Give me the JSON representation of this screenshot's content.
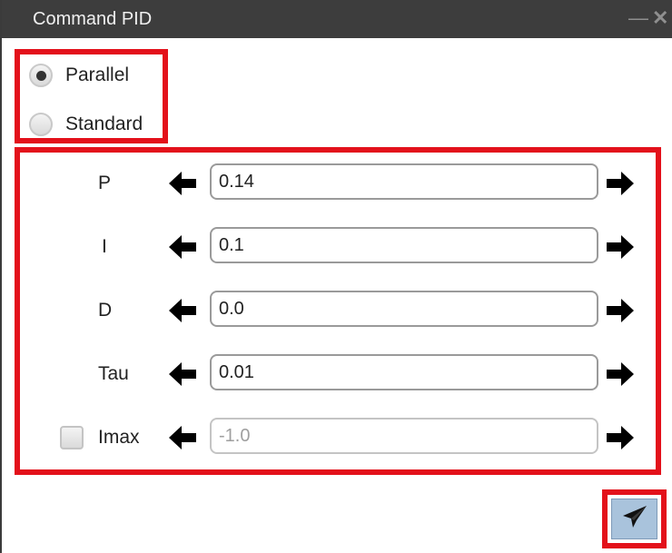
{
  "window": {
    "title": "Command PID",
    "minimize_icon": "minimize-icon",
    "close_icon": "close-icon"
  },
  "mode": {
    "options": [
      {
        "label": "Parallel",
        "selected": true
      },
      {
        "label": "Standard",
        "selected": false
      }
    ]
  },
  "params": [
    {
      "label": "P",
      "value": "0.14",
      "enabled": true
    },
    {
      "label": "I",
      "value": "0.1",
      "enabled": true
    },
    {
      "label": "D",
      "value": "0.0",
      "enabled": true
    },
    {
      "label": "Tau",
      "value": "0.01",
      "enabled": true
    },
    {
      "label": "Imax",
      "value": "-1.0",
      "enabled": false,
      "checkbox_checked": false
    }
  ],
  "icons": {
    "decrement": "arrow-left-icon",
    "increment": "arrow-right-icon",
    "send": "paper-plane-icon"
  },
  "colors": {
    "titlebar": "#3d3d3d",
    "highlight": "#e3111b",
    "send_button": "#a9c3dc"
  }
}
